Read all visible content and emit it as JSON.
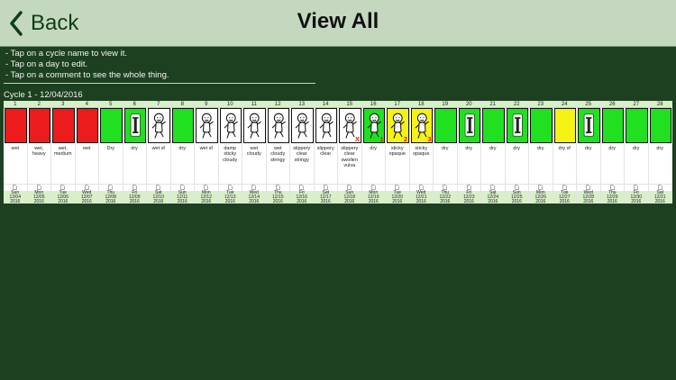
{
  "header": {
    "back_label": "Back",
    "title": "View All"
  },
  "instructions": [
    "- Tap on a cycle name to view it.",
    "- Tap on a day to edit.",
    "- Tap on a comment to see the whole thing."
  ],
  "cycle": {
    "name": "Cycle 1 - 12/04/2016",
    "days": [
      {
        "day": "1",
        "sticker": "red",
        "comment": "wet",
        "weekday": "Sun",
        "date": "12/04",
        "year": "2016"
      },
      {
        "day": "2",
        "sticker": "red",
        "comment": "wet, heavy",
        "weekday": "Mon",
        "date": "12/05",
        "year": "2016"
      },
      {
        "day": "3",
        "sticker": "red",
        "comment": "wet, medium",
        "weekday": "Tue",
        "date": "12/06",
        "year": "2016"
      },
      {
        "day": "4",
        "sticker": "red",
        "comment": "wet",
        "weekday": "Wed",
        "date": "12/07",
        "year": "2016"
      },
      {
        "day": "5",
        "sticker": "green",
        "comment": "Dry",
        "weekday": "Thu",
        "date": "12/08",
        "year": "2016"
      },
      {
        "day": "6",
        "sticker": "green-intercourse",
        "comment": "dry",
        "weekday": "Fri",
        "date": "12/09",
        "year": "2016"
      },
      {
        "day": "7",
        "sticker": "white-baby",
        "comment": "wet sf",
        "weekday": "Sat",
        "date": "12/10",
        "year": "2016"
      },
      {
        "day": "8",
        "sticker": "green",
        "comment": "dry",
        "weekday": "Sun",
        "date": "12/11",
        "year": "2016"
      },
      {
        "day": "9",
        "sticker": "white-baby",
        "comment": "wet sf",
        "weekday": "Mon",
        "date": "12/12",
        "year": "2016"
      },
      {
        "day": "10",
        "sticker": "white-baby",
        "comment": "damp sticky cloudy",
        "weekday": "Tue",
        "date": "12/13",
        "year": "2016"
      },
      {
        "day": "11",
        "sticker": "white-baby",
        "comment": "wet cloudy",
        "weekday": "Wed",
        "date": "12/14",
        "year": "2016"
      },
      {
        "day": "12",
        "sticker": "white-baby",
        "comment": "wet cloudy stringy",
        "weekday": "Thu",
        "date": "12/15",
        "year": "2016"
      },
      {
        "day": "13",
        "sticker": "white-baby",
        "comment": "slippery clear stringy",
        "weekday": "Fri",
        "date": "12/16",
        "year": "2016"
      },
      {
        "day": "14",
        "sticker": "white-baby",
        "comment": "slippery clear",
        "weekday": "Sat",
        "date": "12/17",
        "year": "2016"
      },
      {
        "day": "15",
        "sticker": "white-baby",
        "comment": "slippery clear swollen vulva",
        "weekday": "Sun",
        "date": "12/18",
        "year": "2016",
        "mark": "X"
      },
      {
        "day": "16",
        "sticker": "green-baby",
        "comment": "dry",
        "weekday": "Mon",
        "date": "12/19",
        "year": "2016",
        "mark": "1"
      },
      {
        "day": "17",
        "sticker": "yellow-baby",
        "comment": "sticky opaque",
        "weekday": "Tue",
        "date": "12/20",
        "year": "2016",
        "mark": "2"
      },
      {
        "day": "18",
        "sticker": "yellow-baby",
        "comment": "sticky opaque",
        "weekday": "Wed",
        "date": "12/21",
        "year": "2016",
        "mark": "3"
      },
      {
        "day": "19",
        "sticker": "green",
        "comment": "dry",
        "weekday": "Thu",
        "date": "12/22",
        "year": "2016"
      },
      {
        "day": "20",
        "sticker": "green-intercourse",
        "comment": "dry",
        "weekday": "Fri",
        "date": "12/23",
        "year": "2016"
      },
      {
        "day": "21",
        "sticker": "green",
        "comment": "dry",
        "weekday": "Sat",
        "date": "12/24",
        "year": "2016"
      },
      {
        "day": "22",
        "sticker": "green-intercourse",
        "comment": "dry",
        "weekday": "Sun",
        "date": "12/25",
        "year": "2016"
      },
      {
        "day": "23",
        "sticker": "green",
        "comment": "dry",
        "weekday": "Mon",
        "date": "12/26",
        "year": "2016"
      },
      {
        "day": "24",
        "sticker": "yellow",
        "comment": "dry sf",
        "weekday": "Tue",
        "date": "12/27",
        "year": "2016"
      },
      {
        "day": "25",
        "sticker": "green-intercourse",
        "comment": "dry",
        "weekday": "Wed",
        "date": "12/28",
        "year": "2016"
      },
      {
        "day": "26",
        "sticker": "green",
        "comment": "dry",
        "weekday": "Thu",
        "date": "12/29",
        "year": "2016"
      },
      {
        "day": "27",
        "sticker": "green",
        "comment": "dry",
        "weekday": "Fri",
        "date": "12/30",
        "year": "2016"
      },
      {
        "day": "28",
        "sticker": "green",
        "comment": "dry",
        "weekday": "Sat",
        "date": "12/31",
        "year": "2016"
      }
    ]
  },
  "colors": {
    "red": "#ec1c1c",
    "green": "#20e020",
    "yellow": "#f5f215",
    "white": "#ffffff",
    "mark": "#e01818",
    "background": "#1d4020",
    "header": "#c4d8bf"
  },
  "icons": {
    "back": "chevron-left-icon",
    "note": "note-icon",
    "baby": "baby-icon",
    "intercourse": "intercourse-i-icon"
  }
}
